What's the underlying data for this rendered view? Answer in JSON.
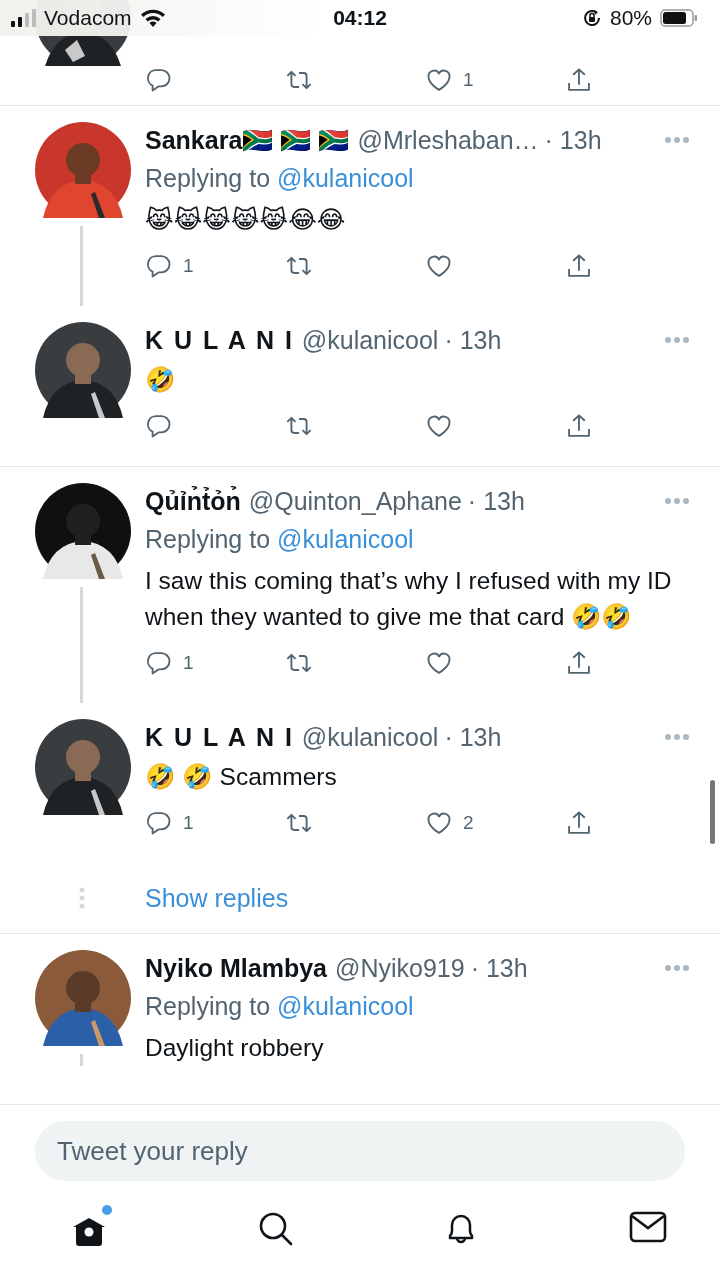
{
  "status_bar": {
    "carrier": "Vodacom",
    "time": "04:12",
    "battery": "80%"
  },
  "partial_tweet": {
    "like_count": "1"
  },
  "tweets": [
    {
      "name": "Sankara🇿🇦 🇿🇦 🇿🇦",
      "handle": "@Mrleshaban…",
      "time": "· 13h",
      "replying_label": "Replying to",
      "replying_handle": "@kulanicool",
      "text": "😹😹😹😹😹😂😂",
      "reply_count": "1",
      "thread_line": true,
      "divider": false
    },
    {
      "name": "K U L A N I",
      "handle": "@kulanicool",
      "time": "· 13h",
      "text": "🤣",
      "thread_line": false,
      "divider": true
    },
    {
      "name": "Qủỉn̉t̉ỏn̉",
      "handle": "@Quinton_Aphane",
      "time": "· 13h",
      "replying_label": "Replying to",
      "replying_handle": "@kulanicool",
      "text": "I saw this coming that’s why I refused with my ID when they wanted to give me that card 🤣🤣",
      "reply_count": "1",
      "thread_line": true,
      "divider": false
    },
    {
      "name": "K U L A N I",
      "handle": "@kulanicool",
      "time": "· 13h",
      "text": "🤣 🤣 Scammers",
      "reply_count": "1",
      "like_count": "2",
      "thread_line": false,
      "show_replies": "Show replies",
      "divider": true
    },
    {
      "name": "Nyiko Mlambya",
      "handle": "@Nyiko919",
      "time": "· 13h",
      "replying_label": "Replying to",
      "replying_handle": "@kulanicool",
      "text": "Daylight robbery",
      "thread_line": true,
      "divider": false
    }
  ],
  "composer": {
    "placeholder": "Tweet your reply"
  },
  "nav": [
    {
      "kind": "home",
      "selected": true,
      "has_new": true
    },
    {
      "kind": "search",
      "selected": false
    },
    {
      "kind": "notifications",
      "selected": false
    },
    {
      "kind": "messages",
      "selected": false
    }
  ]
}
